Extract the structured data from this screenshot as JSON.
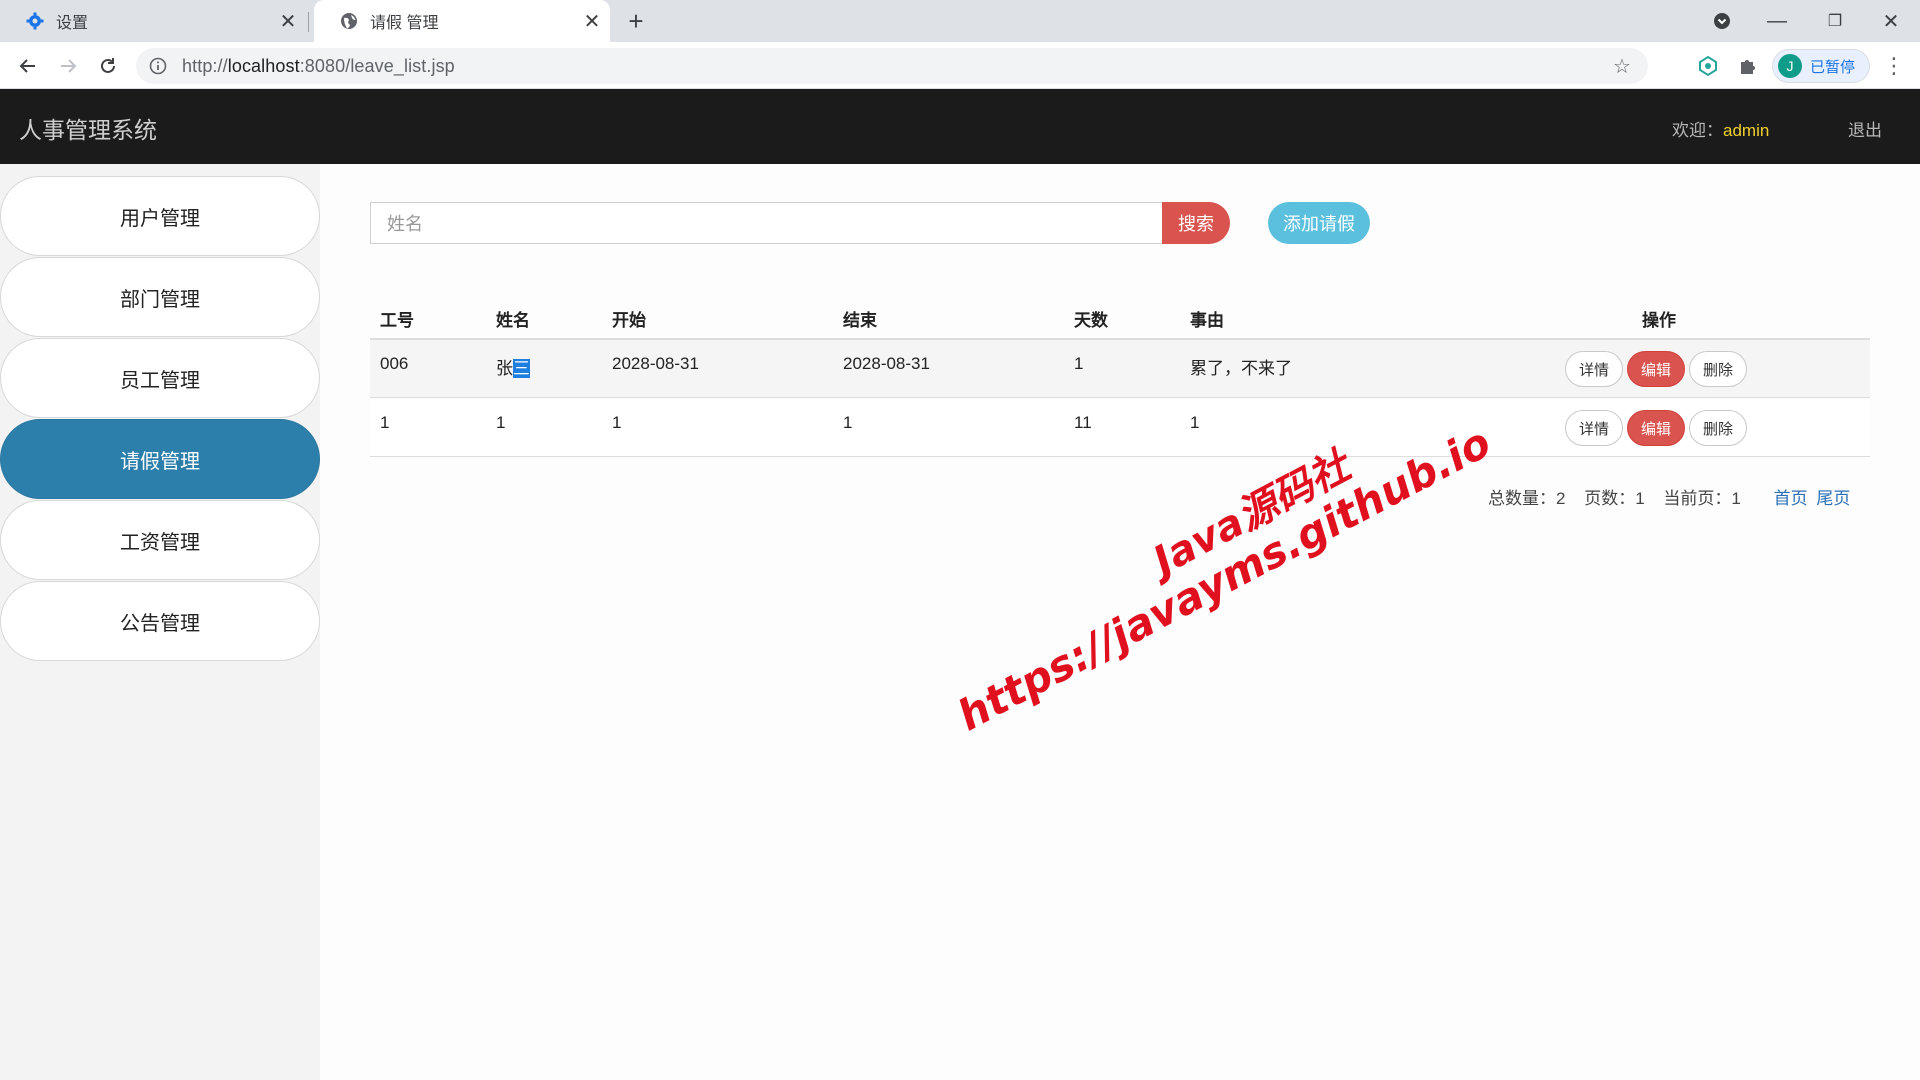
{
  "browser": {
    "tabs": [
      {
        "title": "设置",
        "icon": "gear-icon"
      },
      {
        "title": "请假 管理",
        "icon": "globe-icon"
      }
    ],
    "url_scheme": "http://",
    "url_host": "localhost",
    "url_rest": ":8080/leave_list.jsp",
    "profile_initial": "J",
    "profile_label": "已暂停"
  },
  "app": {
    "brand": "人事管理系统",
    "welcome_label": "欢迎：",
    "username": "admin",
    "logout": "退出"
  },
  "sidebar": {
    "items": [
      {
        "label": "用户管理"
      },
      {
        "label": "部门管理"
      },
      {
        "label": "员工管理"
      },
      {
        "label": "请假管理",
        "active": true
      },
      {
        "label": "工资管理"
      },
      {
        "label": "公告管理"
      }
    ]
  },
  "search": {
    "placeholder": "姓名",
    "button": "搜索",
    "add_button": "添加请假"
  },
  "table": {
    "columns": [
      "工号",
      "姓名",
      "开始",
      "结束",
      "天数",
      "事由",
      "操作"
    ],
    "rows": [
      {
        "id": "006",
        "name_a": "张",
        "name_b": "三",
        "start": "2028-08-31",
        "end": "2028-08-31",
        "days": "1",
        "reason": "累了，不来了"
      },
      {
        "id": "1",
        "name_a": "1",
        "name_b": "",
        "start": "1",
        "end": "1",
        "days": "11",
        "reason": "1"
      }
    ],
    "actions": {
      "detail": "详情",
      "edit": "编辑",
      "delete": "删除"
    }
  },
  "pagination": {
    "total_label": "总数量：2",
    "pages_label": "页数：1",
    "current_label": "当前页：1",
    "first": "首页",
    "last": "尾页"
  },
  "watermark": {
    "line1": "Java源码社",
    "line2": "https://javayms.github.io"
  },
  "colors": {
    "appbar": "#1b1b1b",
    "active_nav": "#2d7fab",
    "danger": "#d9534f",
    "info": "#5bc0de",
    "username": "#f0d12c",
    "watermark": "#e0101e"
  }
}
